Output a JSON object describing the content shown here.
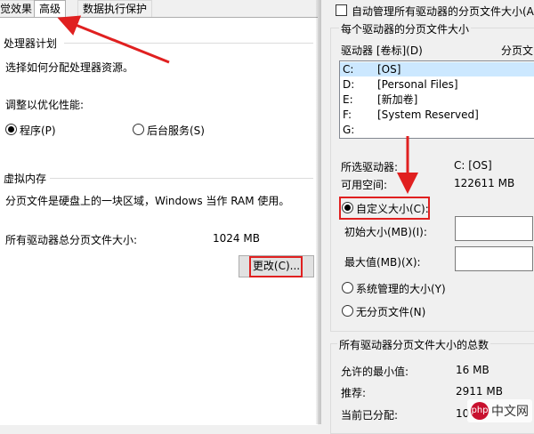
{
  "tabs": [
    "觉效果",
    "高级",
    "数据执行保护"
  ],
  "processor": {
    "title": "处理器计划",
    "desc": "选择如何分配处理器资源。",
    "adjust_label": "调整以优化性能:",
    "option_programs": "程序(P)",
    "option_services": "后台服务(S)"
  },
  "virtual_memory": {
    "title": "虚拟内存",
    "desc": "分页文件是硬盘上的一块区域，Windows 当作 RAM 使用。",
    "total_label": "所有驱动器总分页文件大小:",
    "total_value": "1024 MB",
    "change_button": "更改(C)..."
  },
  "dialog": {
    "auto_manage": "自动管理所有驱动器的分页文件大小(A)",
    "group_title": "每个驱动器的分页文件大小",
    "col_drive": "驱动器 [卷标](D)",
    "col_page": "分页文",
    "drives": [
      {
        "letter": "C:",
        "label": "[OS]",
        "selected": true
      },
      {
        "letter": "D:",
        "label": "[Personal Files]",
        "selected": false
      },
      {
        "letter": "E:",
        "label": "[新加卷]",
        "selected": false
      },
      {
        "letter": "F:",
        "label": "[System Reserved]",
        "selected": false
      },
      {
        "letter": "G:",
        "label": "",
        "selected": false
      }
    ],
    "selected_drive_label": "所选驱动器:",
    "selected_drive_value": "C:   [OS]",
    "free_space_label": "可用空间:",
    "free_space_value": "122611 MB",
    "custom_size": "自定义大小(C):",
    "initial_size_label": "初始大小(MB)(I):",
    "max_size_label": "最大值(MB)(X):",
    "system_managed": "系统管理的大小(Y)",
    "no_paging": "无分页文件(N)",
    "totals_title": "所有驱动器分页文件大小的总数",
    "min_allowed_label": "允许的最小值:",
    "min_allowed_value": "16 MB",
    "recommended_label": "推荐:",
    "recommended_value": "2911 MB",
    "current_label": "当前已分配:",
    "current_value": "10"
  },
  "watermark": {
    "logo": "php",
    "text": "中文网"
  },
  "colors": {
    "annotation": "#e02020",
    "selection": "#cce8ff"
  }
}
